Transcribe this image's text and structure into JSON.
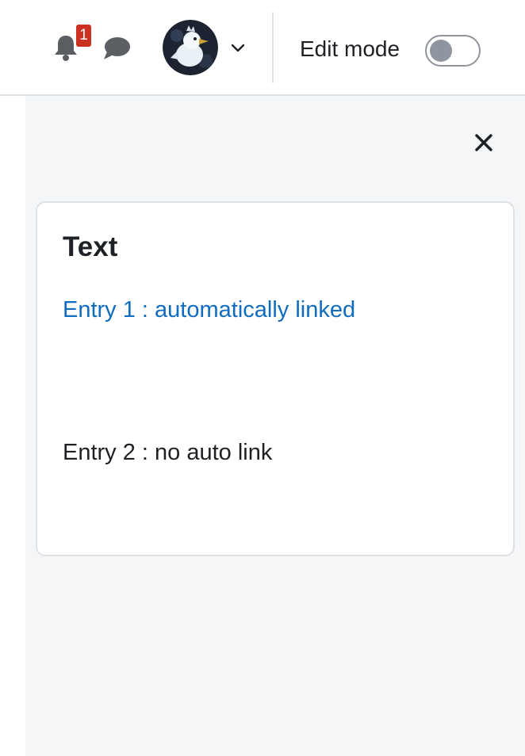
{
  "header": {
    "notifications": {
      "icon": "bell-icon",
      "count": "1",
      "badge_color": "#ca3120"
    },
    "messages": {
      "icon": "chat-icon"
    },
    "user_menu": {
      "avatar": "avatar",
      "caret": "chevron-down-icon"
    },
    "edit_mode": {
      "label": "Edit mode",
      "enabled": false
    }
  },
  "drawer": {
    "close_icon": "close-icon",
    "block": {
      "title": "Text",
      "entries": [
        {
          "text": "Entry 1 : automatically linked",
          "linked": true
        },
        {
          "text": "Entry 2 : no auto link",
          "linked": false
        }
      ]
    }
  },
  "colors": {
    "link": "#0f6cbf",
    "text": "#1d2125",
    "drawer_bg": "#f5f6f8",
    "border": "#dee2e6",
    "toggle_off": "#8f959e"
  }
}
